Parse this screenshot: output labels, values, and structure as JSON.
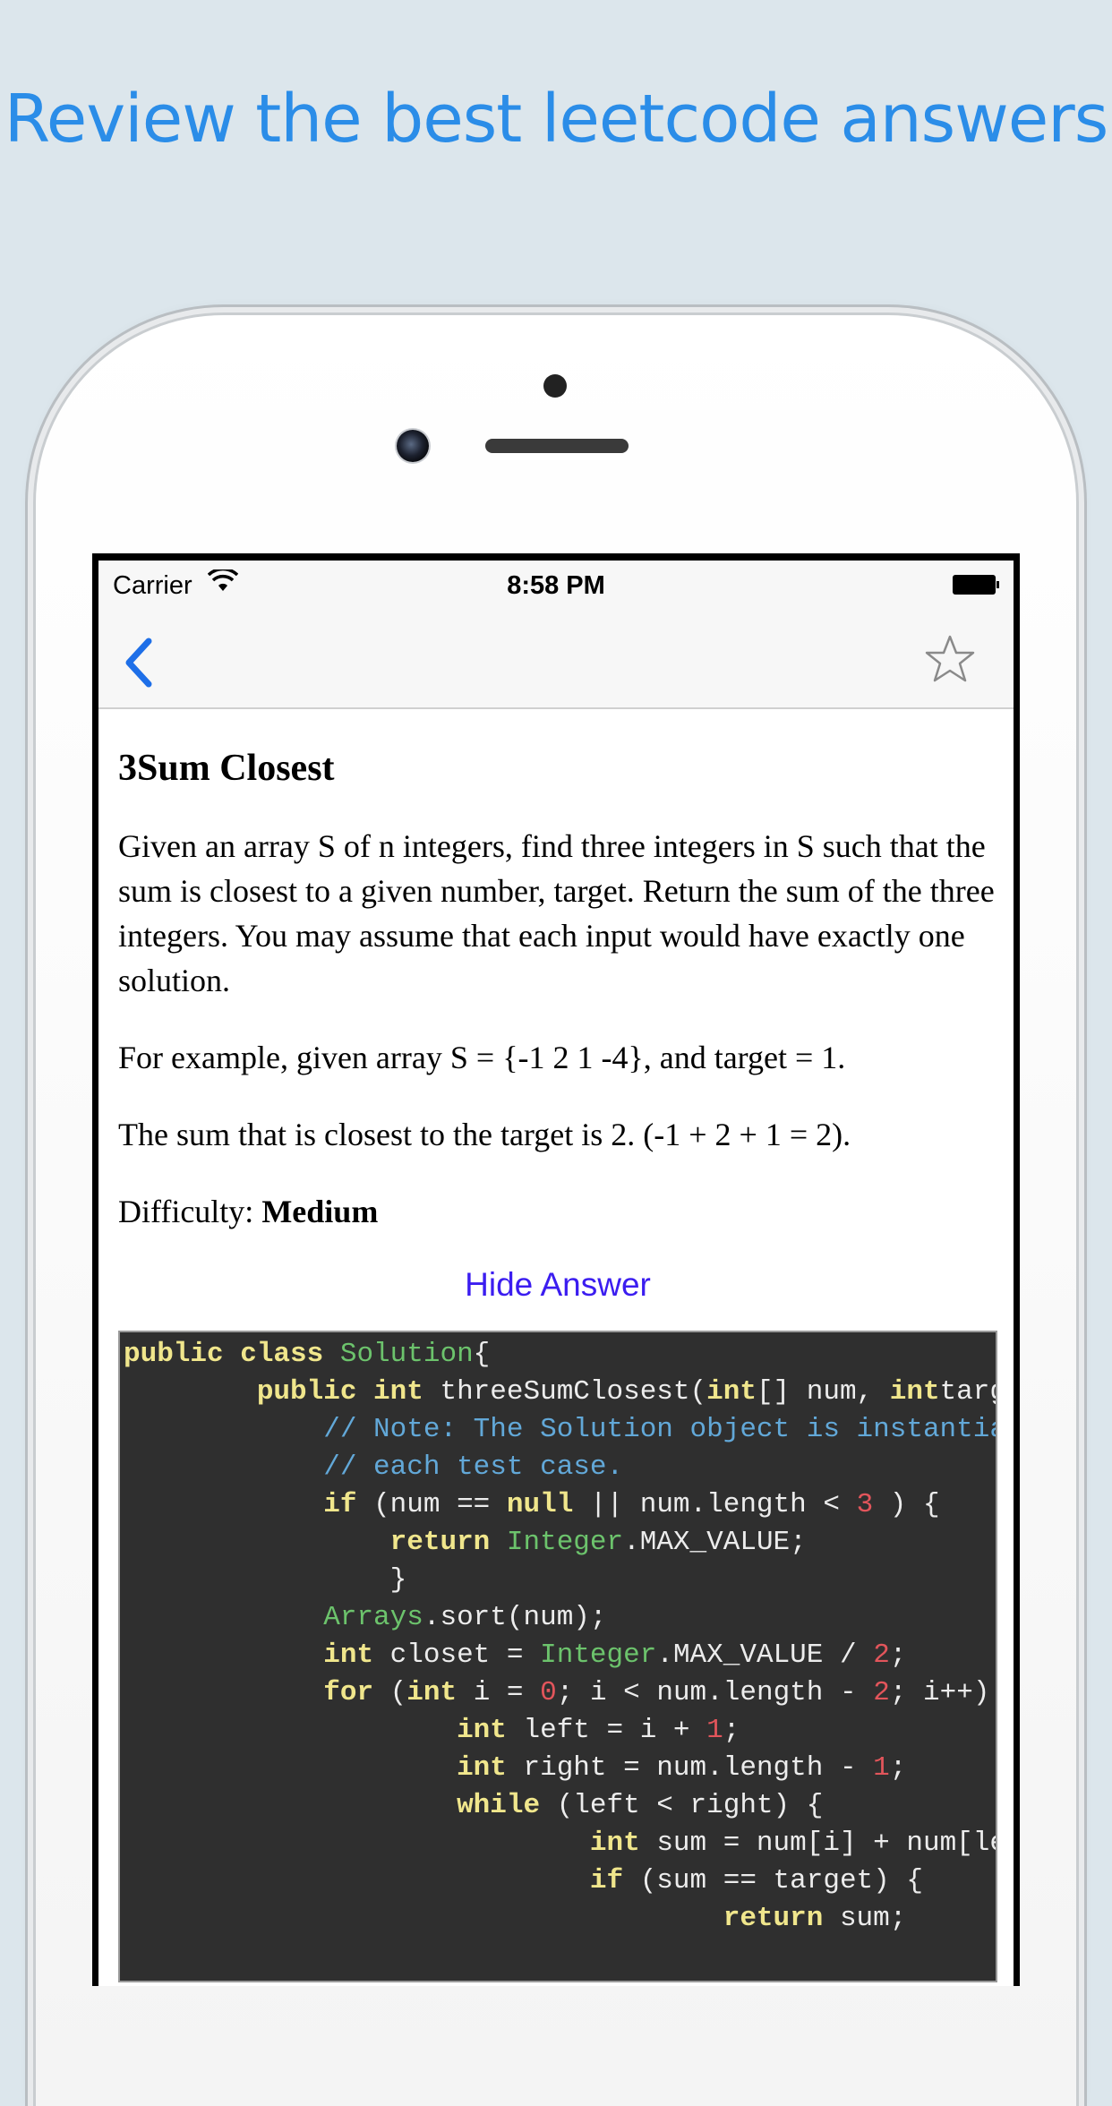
{
  "headline": "Review the best leetcode answers",
  "status_bar": {
    "carrier": "Carrier",
    "time": "8:58 PM"
  },
  "nav": {
    "back_icon": "chevron-left-icon",
    "favorite_icon": "star-outline-icon"
  },
  "problem": {
    "title": "3Sum Closest",
    "description": "Given an array S of n integers, find three integers in S such that the sum is closest to a given number, target. Return the sum of the three integers. You may assume that each input would have exactly one solution.",
    "example": "For example, given array S = {-1 2 1 -4}, and target = 1.",
    "explanation": "The sum that is closest to the target is 2. (-1 + 2 + 1 = 2).",
    "difficulty_label": "Difficulty:",
    "difficulty_value": "Medium"
  },
  "hide_answer_label": "Hide Answer",
  "code_lines": [
    [
      [
        "kw",
        "public class "
      ],
      [
        "cls",
        "Solution"
      ],
      [
        "",
        "{"
      ]
    ],
    [
      [
        "",
        "        "
      ],
      [
        "kw",
        "public int "
      ],
      [
        "",
        "threeSumClosest("
      ],
      [
        "kw",
        "int"
      ],
      [
        "",
        "[] num, "
      ],
      [
        "kw",
        "int"
      ],
      [
        "",
        "target) {"
      ]
    ],
    [
      [
        "",
        "            "
      ],
      [
        "cm",
        "// Note: The Solution object is instantiated only once"
      ]
    ],
    [
      [
        "",
        "            "
      ],
      [
        "cm",
        "// each test case."
      ]
    ],
    [
      [
        "",
        "            "
      ],
      [
        "kw",
        "if "
      ],
      [
        "",
        "(num == "
      ],
      [
        "kw",
        "null "
      ],
      [
        "",
        "|| num.length < "
      ],
      [
        "num",
        "3"
      ],
      [
        "",
        " ) {"
      ]
    ],
    [
      [
        "",
        "                "
      ],
      [
        "kw",
        "return "
      ],
      [
        "cls",
        "Integer"
      ],
      [
        "",
        ".MAX_VALUE;"
      ]
    ],
    [
      [
        "",
        "                }"
      ]
    ],
    [
      [
        "",
        "            "
      ],
      [
        "cls",
        "Arrays"
      ],
      [
        "",
        ".sort(num);"
      ]
    ],
    [
      [
        "",
        "            "
      ],
      [
        "kw",
        "int "
      ],
      [
        "",
        "closet = "
      ],
      [
        "cls",
        "Integer"
      ],
      [
        "",
        ".MAX_VALUE / "
      ],
      [
        "num",
        "2"
      ],
      [
        "",
        ";"
      ]
    ],
    [
      [
        "",
        "            "
      ],
      [
        "kw",
        "for "
      ],
      [
        "",
        "("
      ],
      [
        "kw",
        "int "
      ],
      [
        "",
        "i = "
      ],
      [
        "num",
        "0"
      ],
      [
        "",
        "; i < num.length - "
      ],
      [
        "num",
        "2"
      ],
      [
        "",
        "; i++) {"
      ]
    ],
    [
      [
        "",
        "                    "
      ],
      [
        "kw",
        "int "
      ],
      [
        "",
        "left = i + "
      ],
      [
        "num",
        "1"
      ],
      [
        "",
        ";"
      ]
    ],
    [
      [
        "",
        "                    "
      ],
      [
        "kw",
        "int "
      ],
      [
        "",
        "right = num.length - "
      ],
      [
        "num",
        "1"
      ],
      [
        "",
        ";"
      ]
    ],
    [
      [
        "",
        "                    "
      ],
      [
        "kw",
        "while "
      ],
      [
        "",
        "(left < right) {"
      ]
    ],
    [
      [
        "",
        "                            "
      ],
      [
        "kw",
        "int "
      ],
      [
        "",
        "sum = num[i] + num[left] + num[right];"
      ]
    ],
    [
      [
        "",
        "                            "
      ],
      [
        "kw",
        "if "
      ],
      [
        "",
        "(sum == target) {"
      ]
    ],
    [
      [
        "",
        "                                    "
      ],
      [
        "kw",
        "return "
      ],
      [
        "",
        "sum;"
      ]
    ]
  ]
}
